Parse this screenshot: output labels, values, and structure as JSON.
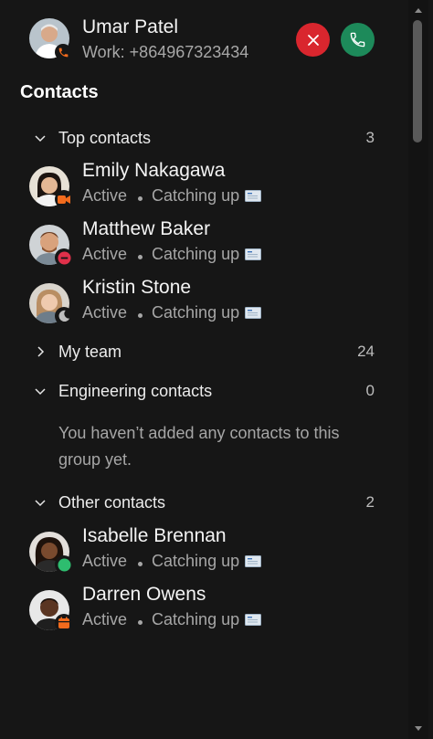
{
  "incoming_call": {
    "caller_name": "Umar Patel",
    "caller_number": "Work: +864967323434",
    "decline_color": "#d9262e",
    "answer_color": "#1d8a5a"
  },
  "contacts_heading": "Contacts",
  "groups": {
    "top": {
      "label": "Top contacts",
      "count": "3",
      "expanded": true
    },
    "team": {
      "label": "My team",
      "count": "24",
      "expanded": false
    },
    "engineering": {
      "label": "Engineering contacts",
      "count": "0",
      "expanded": true,
      "empty_message": "You haven’t added any contacts to this group yet."
    },
    "other": {
      "label": "Other contacts",
      "count": "2",
      "expanded": true
    }
  },
  "contacts": [
    {
      "name": "Emily Nakagawa",
      "presence": "Active",
      "activity": "Catching up",
      "status_icon": "video-icon",
      "status_color": "#f26b1d"
    },
    {
      "name": "Matthew Baker",
      "presence": "Active",
      "activity": "Catching up",
      "status_icon": "do-not-disturb-icon",
      "status_color": "#e0304a"
    },
    {
      "name": "Kristin Stone",
      "presence": "Active",
      "activity": "Catching up",
      "status_icon": "moon-icon",
      "status_color": "#bdbdbd"
    },
    {
      "name": "Isabelle Brennan",
      "presence": "Active",
      "activity": "Catching up",
      "status_icon": "available-icon",
      "status_color": "#2ebd6f"
    },
    {
      "name": "Darren Owens",
      "presence": "Active",
      "activity": "Catching up",
      "status_icon": "calendar-icon",
      "status_color": "#f26b1d"
    }
  ]
}
